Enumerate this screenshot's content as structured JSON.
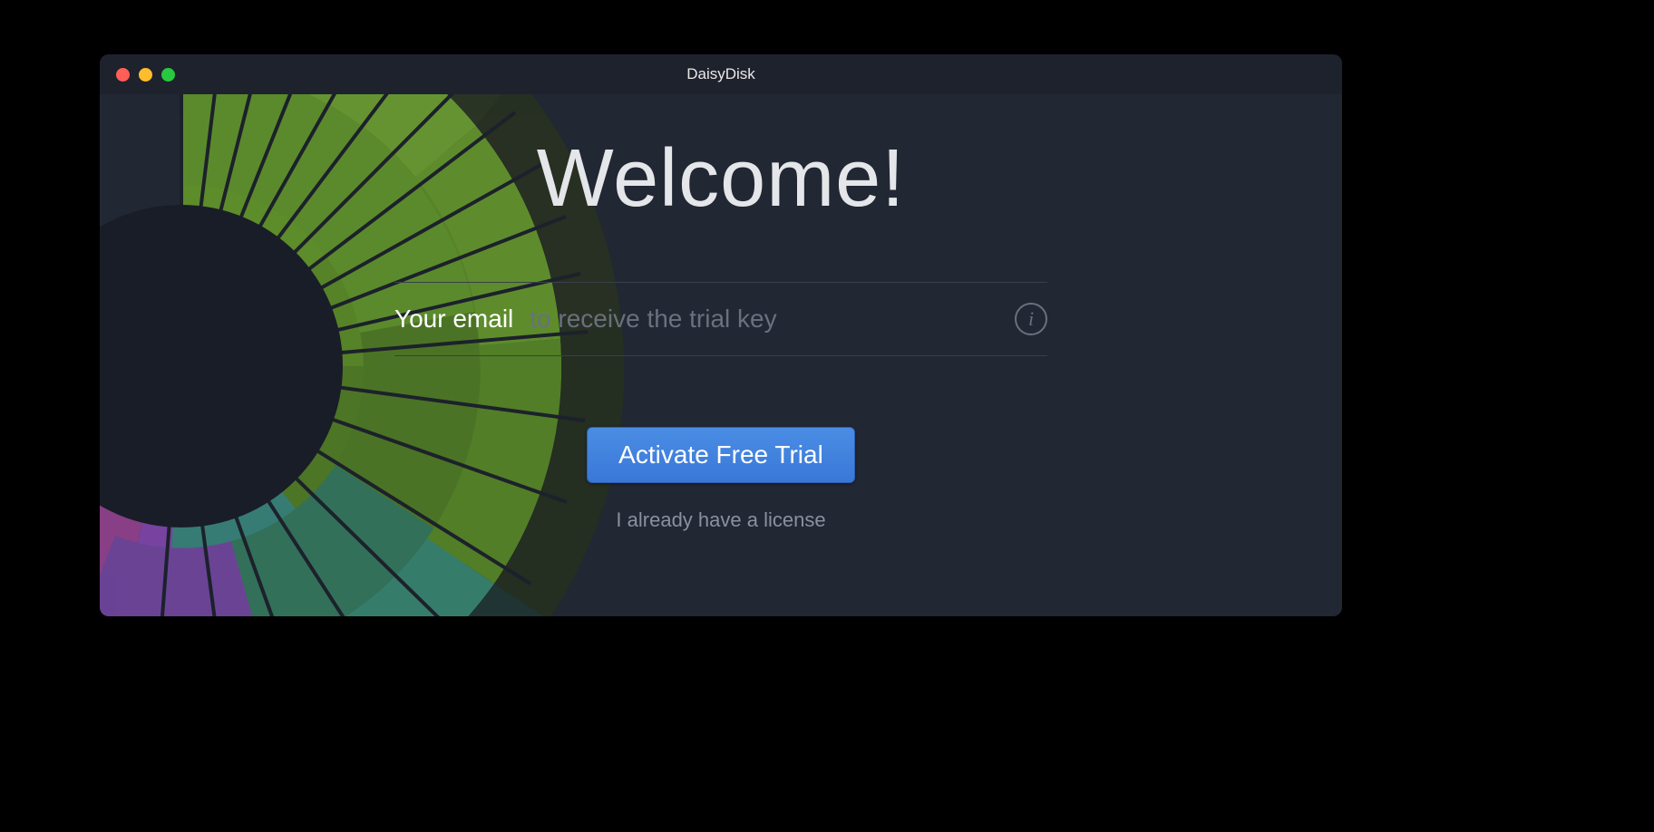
{
  "titlebar": {
    "title": "DaisyDisk"
  },
  "main": {
    "heading": "Welcome!",
    "email_label": "Your email",
    "email_placeholder": "to receive the trial key",
    "info_icon_glyph": "i",
    "activate_button": "Activate Free Trial",
    "license_link": "I already have a license"
  },
  "colors": {
    "window_bg": "#212733",
    "accent": "#3a78d8"
  }
}
